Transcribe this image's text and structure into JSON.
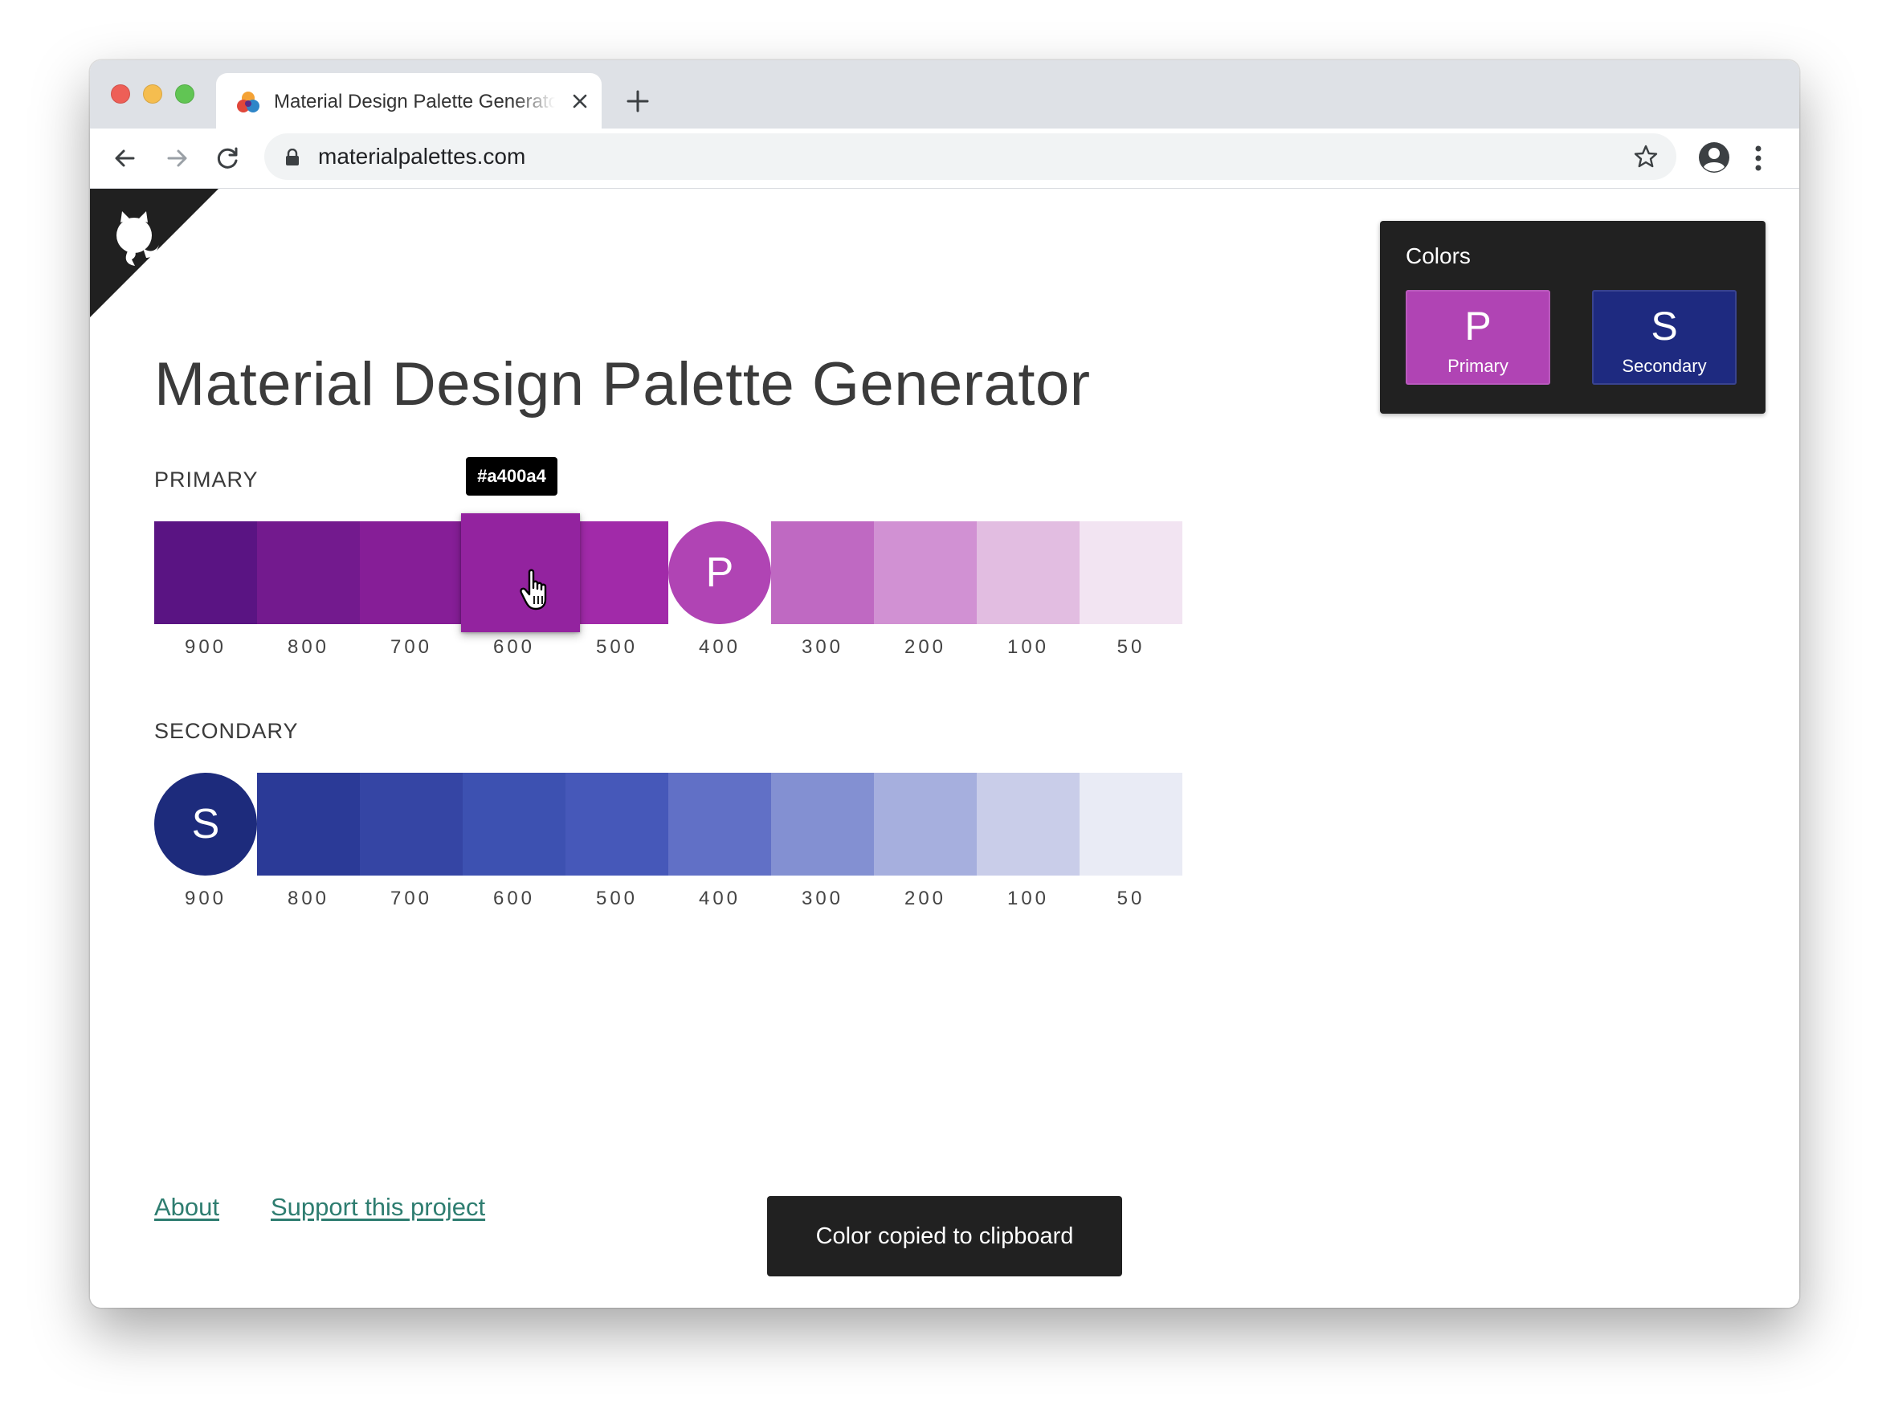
{
  "browser": {
    "tab_title": "Material Design Palette Generator",
    "url": "materialpalettes.com"
  },
  "page": {
    "title": "Material Design Palette Generator",
    "tooltip": "#a400a4"
  },
  "primary": {
    "label": "PRIMARY",
    "shades": [
      "900",
      "800",
      "700",
      "600",
      "500",
      "400",
      "300",
      "200",
      "100",
      "50"
    ],
    "colors": [
      "#5a1483",
      "#731a8e",
      "#861e97",
      "#93239f",
      "#a12aa9",
      "#b044b4",
      "#bf69c2",
      "#d191d3",
      "#e2bde1",
      "#f2e4f2"
    ],
    "key_index": 5,
    "key_letter": "P",
    "raised_index": 3
  },
  "secondary": {
    "label": "SECONDARY",
    "shades": [
      "900",
      "800",
      "700",
      "600",
      "500",
      "400",
      "300",
      "200",
      "100",
      "50"
    ],
    "colors": [
      "#1d2b7c",
      "#2b3a97",
      "#3545a4",
      "#3d51b1",
      "#4658b9",
      "#6170c6",
      "#8390d2",
      "#a6afde",
      "#c9cde9",
      "#e9ebf5"
    ],
    "key_index": 0,
    "key_letter": "S"
  },
  "colors_panel": {
    "title": "Colors",
    "primary": {
      "letter": "P",
      "label": "Primary",
      "color": "#b044b4"
    },
    "secondary": {
      "letter": "S",
      "label": "Secondary",
      "color": "#1e2a80"
    }
  },
  "footer": {
    "about": "About",
    "support": "Support this project"
  },
  "snackbar": "Color copied to clipboard"
}
